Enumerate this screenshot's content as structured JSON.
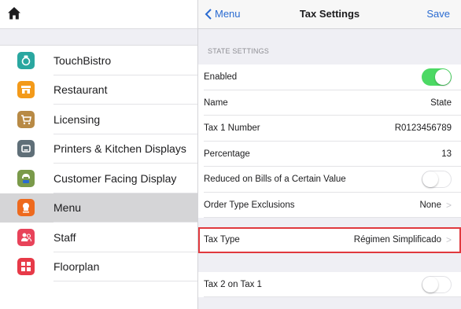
{
  "sidebar": {
    "items": [
      {
        "label": "TouchBistro",
        "color": "#2aa7a0",
        "icon": "touchbistro-icon"
      },
      {
        "label": "Restaurant",
        "color": "#f39a1a",
        "icon": "storefront-icon"
      },
      {
        "label": "Licensing",
        "color": "#b88a45",
        "icon": "cart-icon"
      },
      {
        "label": "Printers & Kitchen Displays",
        "color": "#5f6f78",
        "icon": "printer-icon"
      },
      {
        "label": "Customer Facing Display",
        "color": "#7a9a4a",
        "icon": "cfd-icon"
      },
      {
        "label": "Menu",
        "color": "#ee6a1e",
        "icon": "chef-icon"
      },
      {
        "label": "Staff",
        "color": "#e8435a",
        "icon": "staff-icon"
      },
      {
        "label": "Floorplan",
        "color": "#e73a48",
        "icon": "floorplan-icon"
      }
    ]
  },
  "nav": {
    "back_label": "Menu",
    "title": "Tax Settings",
    "save_label": "Save"
  },
  "section_header": "STATE SETTINGS",
  "rows": {
    "enabled": {
      "label": "Enabled",
      "on": true
    },
    "name": {
      "label": "Name",
      "value": "State"
    },
    "tax1_number": {
      "label": "Tax 1 Number",
      "value": "R0123456789"
    },
    "percentage": {
      "label": "Percentage",
      "value": "13"
    },
    "reduced": {
      "label": "Reduced on Bills of a Certain Value",
      "on": false
    },
    "order_type": {
      "label": "Order Type Exclusions",
      "value": "None"
    },
    "tax_type": {
      "label": "Tax Type",
      "value": "Régimen Simplificado"
    },
    "tax2_on_tax1": {
      "label": "Tax 2 on Tax 1",
      "on": false
    }
  },
  "colors": {
    "accent": "#2a6bd1",
    "toggle_on": "#4cd964",
    "highlight": "#e0393e",
    "selected_row": "#d5d5d7"
  }
}
